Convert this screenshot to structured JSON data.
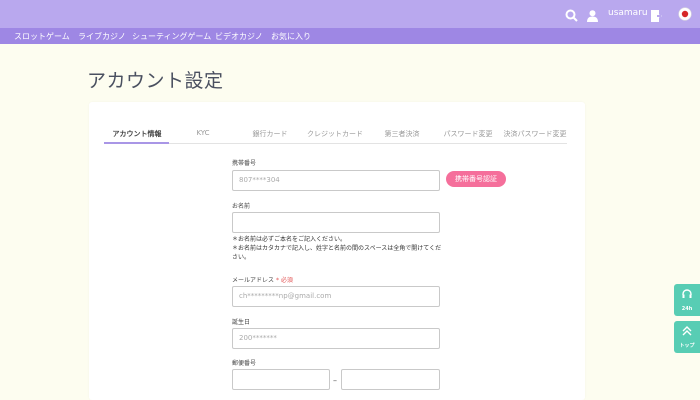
{
  "header": {
    "username": "usamaru",
    "icons": [
      "search-icon",
      "user-icon",
      "logout-icon",
      "flag-icon"
    ]
  },
  "nav": {
    "items": [
      "スロットゲーム",
      "ライブカジノ",
      "シューティングゲーム",
      "ビデオカジノ",
      "お気に入り"
    ]
  },
  "page": {
    "title": "アカウント設定"
  },
  "tabs": [
    "アカウント情報",
    "KYC",
    "銀行カード",
    "クレジットカード",
    "第三者決済",
    "パスワード変更",
    "決済パスワード変更"
  ],
  "form": {
    "phone": {
      "label": "携帯番号",
      "value": "807****304",
      "verify_button": "携帯番号認証"
    },
    "name": {
      "label": "お名前",
      "value": "",
      "note1": "＊お名前は必ずご本名をご記入ください。",
      "note2": "＊お名前はカタカナで記入し、姓字と名前の間のスペースは全角で開けてください。"
    },
    "email": {
      "label": "メールアドレス",
      "required": "* 必須",
      "value": "ch*********np@gmail.com"
    },
    "birthday": {
      "label": "誕生日",
      "value": "200*******"
    },
    "postal": {
      "label": "郵便番号",
      "separator": "–"
    }
  },
  "sidebar_buttons": {
    "support": "24h",
    "top": "トップ"
  },
  "colors": {
    "topbar": "#b9a8ee",
    "navbar": "#9e87e4",
    "accent": "#f56f9b",
    "side_button": "#58cdb4",
    "background": "#fdfdf0"
  }
}
